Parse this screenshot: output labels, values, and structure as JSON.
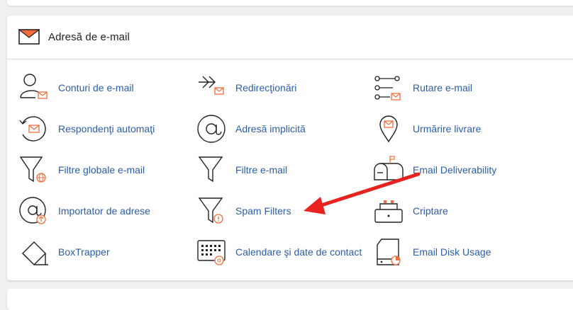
{
  "section": {
    "title": "Adresă de e-mail"
  },
  "items": [
    {
      "label": "Conturi de e-mail"
    },
    {
      "label": "Redirecţionări"
    },
    {
      "label": "Rutare e-mail"
    },
    {
      "label": "Respondenţi automaţi"
    },
    {
      "label": "Adresă implicită"
    },
    {
      "label": "Urmărire livrare"
    },
    {
      "label": "Filtre globale e-mail"
    },
    {
      "label": "Filtre e-mail"
    },
    {
      "label": "Email Deliverability"
    },
    {
      "label": "Importator de adrese"
    },
    {
      "label": "Spam Filters"
    },
    {
      "label": "Criptare"
    },
    {
      "label": "BoxTrapper"
    },
    {
      "label": "Calendare şi date de contact"
    },
    {
      "label": "Email Disk Usage"
    }
  ],
  "colors": {
    "link": "#2b5ea8",
    "accent": "#f26d3d",
    "annotation_arrow": "#e8231f"
  }
}
